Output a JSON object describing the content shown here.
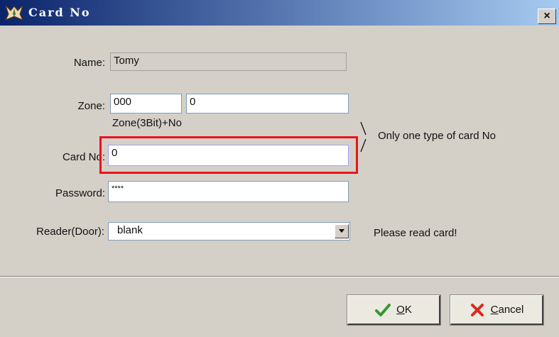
{
  "window": {
    "title": "Card No",
    "close_glyph": "×",
    "title_icon": "app-logo-icon"
  },
  "form": {
    "name_label": "Name:",
    "name_value": "Tomy",
    "zone_label": "Zone:",
    "zone_value": "000",
    "zone_no_value": "0",
    "zone_hint": "Zone(3Bit)+No",
    "card_no_label": "Card No:",
    "card_no_value": "0",
    "password_label": "Password:",
    "password_value": "****",
    "reader_label": "Reader(Door):",
    "reader_value": "blank",
    "reader_dropdown_icon": "chevron-down-icon"
  },
  "notes": {
    "only_one_type": "Only one type of card No",
    "please_read": "Please read card!"
  },
  "buttons": {
    "ok_label": "OK",
    "ok_icon": "checkmark-icon",
    "cancel_label": "Cancel",
    "cancel_icon": "x-icon"
  },
  "colors": {
    "highlight_border": "#e8141c",
    "check_green": "#2e9a2e",
    "cancel_red": "#d92a1c"
  }
}
